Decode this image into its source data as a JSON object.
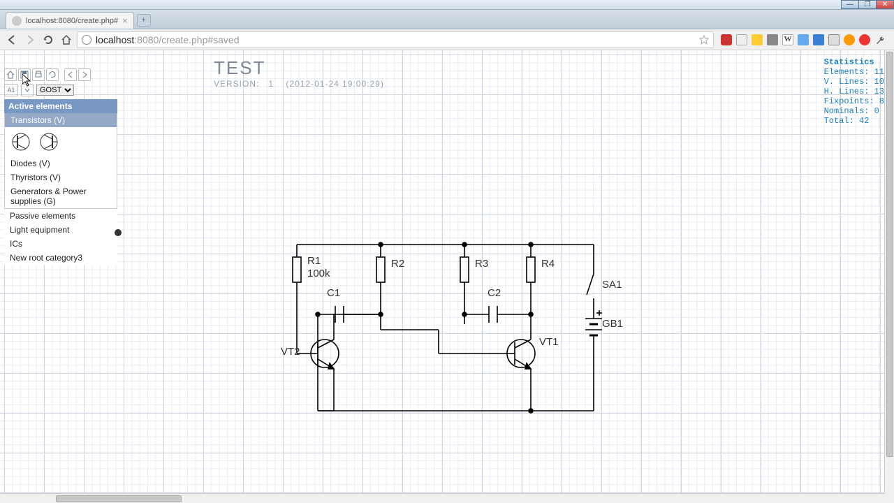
{
  "browser": {
    "tab_title": "localhost:8080/create.php#",
    "url_host": "localhost",
    "url_port": ":8080",
    "url_path": "/create.php#saved"
  },
  "toolbar": {
    "select_label": "GOST"
  },
  "sidebar": {
    "header": "Active elements",
    "active_sub": "Transistors (V)",
    "items": [
      "Diodes (V)",
      "Thyristors (V)",
      "Generators & Power supplies (G)"
    ],
    "items2": [
      "Passive elements",
      "Light equipment",
      "ICs",
      "New root category3"
    ]
  },
  "title": {
    "name": "TEST",
    "version_label": "VERSION:",
    "version": "1",
    "date": "(2012-01-24 19:00:29)"
  },
  "stats": {
    "header": "Statistics",
    "rows": [
      "Elements: 11",
      "V. Lines: 10",
      "H. Lines: 13",
      "Fixpoints: 8",
      "Nominals: 0",
      "Total: 42"
    ]
  },
  "schematic": {
    "R1": "R1",
    "R1val": "100k",
    "R2": "R2",
    "R3": "R3",
    "R4": "R4",
    "C1": "C1",
    "C2": "C2",
    "VT1": "VT1",
    "VT2": "VT2",
    "SA1": "SA1",
    "GB1": "GB1"
  }
}
